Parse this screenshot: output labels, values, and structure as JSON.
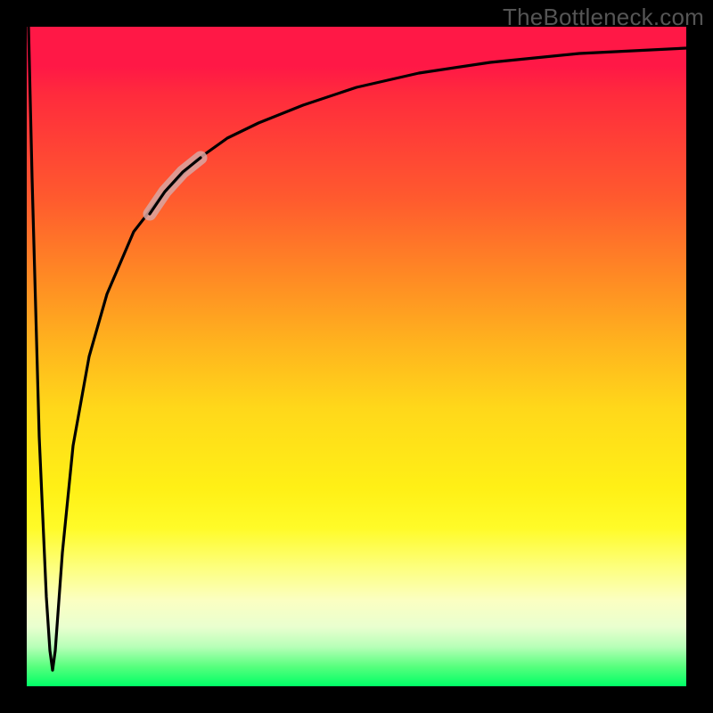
{
  "watermark": {
    "text": "TheBottleneck.com"
  },
  "chart_data": {
    "type": "line",
    "title": "",
    "xlabel": "",
    "ylabel": "",
    "xlim": [
      0,
      100
    ],
    "ylim": [
      0,
      100
    ],
    "grid": false,
    "series": [
      {
        "name": "curve",
        "x": [
          0,
          1,
          2,
          3,
          3.5,
          4,
          5,
          6,
          8,
          10,
          14,
          18,
          22,
          26,
          30,
          38,
          46,
          55,
          65,
          80,
          100
        ],
        "y": [
          100,
          60,
          25,
          5,
          2,
          6,
          20,
          35,
          52,
          62,
          72,
          78,
          82,
          85,
          88,
          91,
          93,
          95,
          96,
          97,
          97.5
        ]
      }
    ],
    "highlight_band": {
      "x_range": [
        18,
        26
      ],
      "note": "faded overlay segment on curve"
    },
    "background_gradient": [
      "#ff1846",
      "#ff8a24",
      "#fff016",
      "#00ff66"
    ]
  }
}
